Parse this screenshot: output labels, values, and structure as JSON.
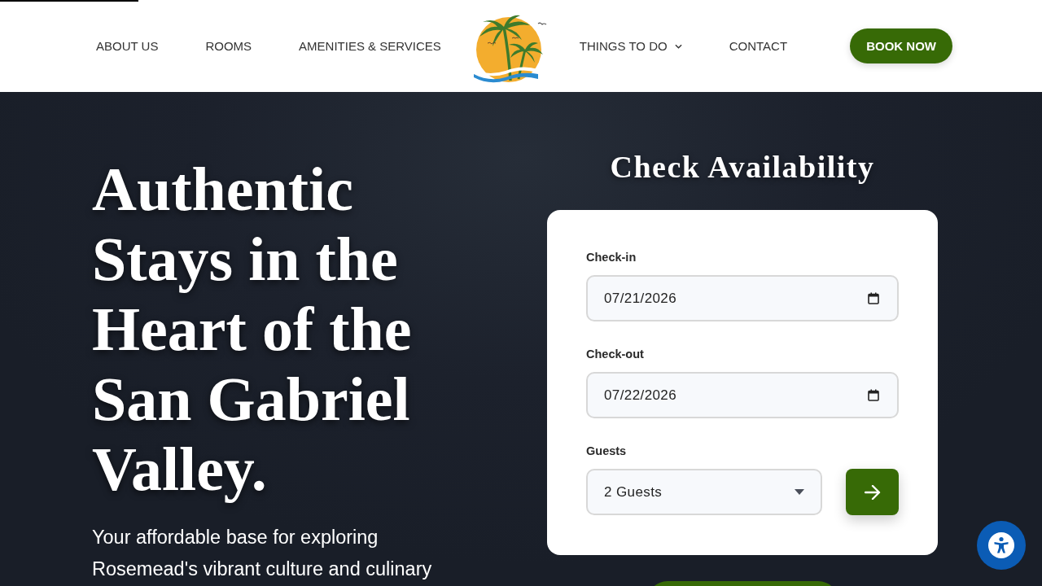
{
  "header": {
    "nav_left": [
      {
        "label": "ABOUT US",
        "kind": "link"
      },
      {
        "label": "ROOMS",
        "kind": "link"
      },
      {
        "label": "AMENITIES & SERVICES",
        "kind": "link"
      }
    ],
    "nav_right": [
      {
        "label": "THINGS TO DO",
        "kind": "dropdown"
      },
      {
        "label": "CONTACT",
        "kind": "link"
      }
    ],
    "cta": "BOOK NOW"
  },
  "hero": {
    "title": "Authentic Stays in the Heart of the San Gabriel Valley.",
    "subtitle": "Your affordable base for exploring Rosemead's vibrant culture and culinary"
  },
  "booking": {
    "title": "Check Availability",
    "fields": [
      {
        "kind": "date",
        "label": "Check-in",
        "value": "07/21/2026"
      },
      {
        "kind": "date",
        "label": "Check-out",
        "value": "07/22/2026"
      },
      {
        "kind": "select",
        "label": "Guests",
        "value": "2 Guests"
      }
    ]
  }
}
